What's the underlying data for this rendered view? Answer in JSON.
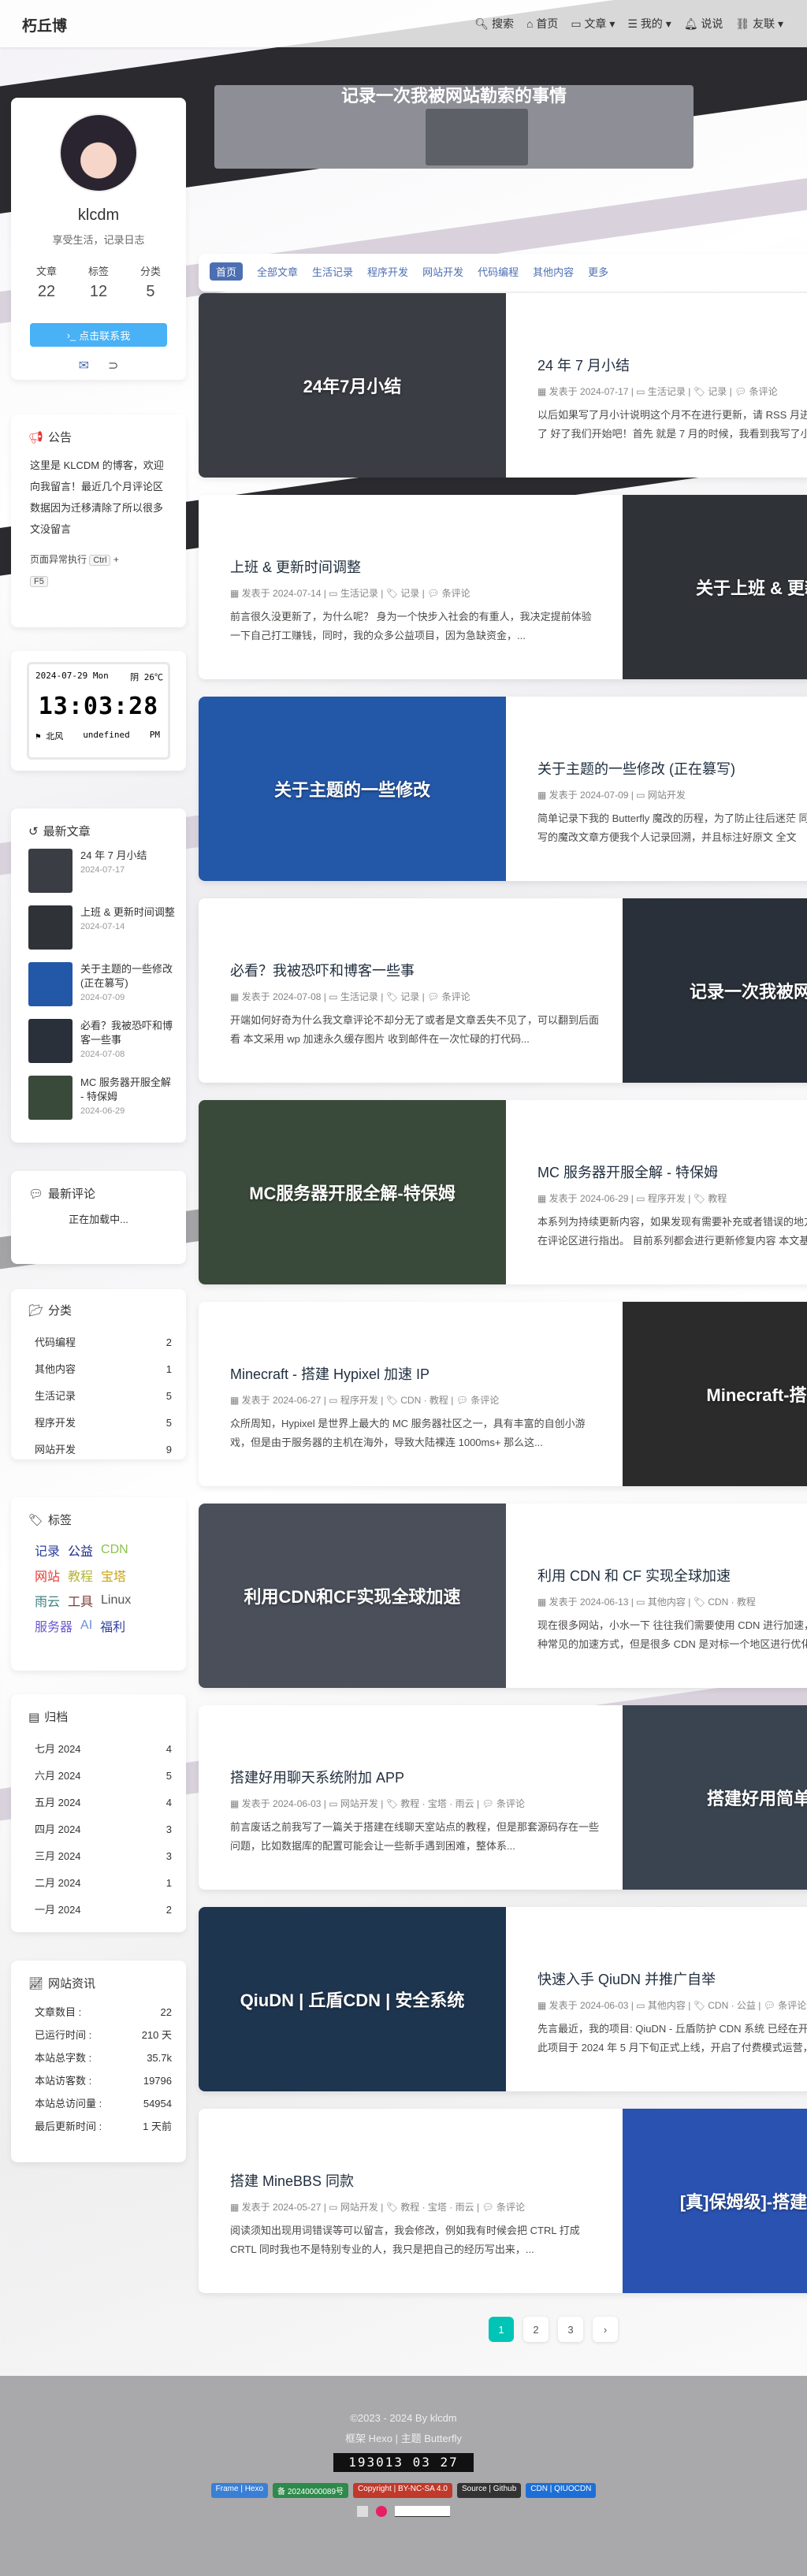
{
  "nav": {
    "site_name": "朽丘博",
    "menus": [
      "搜索",
      "首页",
      "文章",
      "我的",
      "说说",
      "友联"
    ]
  },
  "profile": {
    "name": "klcdm",
    "desc": "享受生活，记录日志",
    "stats": [
      {
        "label": "文章",
        "value": "22"
      },
      {
        "label": "标签",
        "value": "12"
      },
      {
        "label": "分类",
        "value": "5"
      }
    ],
    "contact": "点击联系我"
  },
  "announce": {
    "title": "公告",
    "text": "这里是 KLCDM 的博客，欢迎向我留言！最近几个月评论区数据因为迁移清除了所以很多文没留言",
    "hint_pre": "页面异常执行",
    "key1": "Ctrl",
    "plus": "+",
    "key2": "F5"
  },
  "clock": {
    "date": "2024-07-29",
    "weekday": "Mon",
    "weather": "阴 26℃",
    "time": "13:03:28",
    "wind": "北风",
    "loc": "undefined",
    "ampm": "PM"
  },
  "recent": {
    "title": "最新文章",
    "items": [
      {
        "title": "24 年 7 月小结",
        "date": "2024-07-17"
      },
      {
        "title": "上班 & 更新时间调整",
        "date": "2024-07-14"
      },
      {
        "title": "关于主题的一些修改 (正在篡写)",
        "date": "2024-07-09"
      },
      {
        "title": "必看？我被恐吓和博客一些事",
        "date": "2024-07-08"
      },
      {
        "title": "MC 服务器开服全解 - 特保姆",
        "date": "2024-06-29"
      }
    ]
  },
  "comments": {
    "title": "最新评论",
    "loading": "正在加载中..."
  },
  "categories": {
    "title": "分类",
    "items": [
      {
        "name": "代码编程",
        "count": "2"
      },
      {
        "name": "其他内容",
        "count": "1"
      },
      {
        "name": "生活记录",
        "count": "5"
      },
      {
        "name": "程序开发",
        "count": "5"
      },
      {
        "name": "网站开发",
        "count": "9"
      }
    ]
  },
  "tags": {
    "title": "标签",
    "rows": [
      [
        {
          "t": "记录",
          "c": "#2c3e9e"
        },
        {
          "t": "公益",
          "c": "#1d2a88"
        },
        {
          "t": "CDN",
          "c": "#8bc34a"
        }
      ],
      [
        {
          "t": "网站",
          "c": "#e53935"
        },
        {
          "t": "教程",
          "c": "#b4b43a"
        },
        {
          "t": "宝塔",
          "c": "#c9a215"
        }
      ],
      [
        {
          "t": "雨云",
          "c": "#3f7f7f"
        },
        {
          "t": "工具",
          "c": "#7a3a3a"
        },
        {
          "t": "Linux",
          "c": "#555"
        }
      ],
      [
        {
          "t": "服务器",
          "c": "#6a5acd"
        },
        {
          "t": "AI",
          "c": "#6a8fd0"
        },
        {
          "t": "福利",
          "c": "#2c3e9e"
        }
      ]
    ]
  },
  "archive": {
    "title": "归档",
    "items": [
      {
        "m": "七月 2024",
        "c": "4"
      },
      {
        "m": "六月 2024",
        "c": "5"
      },
      {
        "m": "五月 2024",
        "c": "4"
      },
      {
        "m": "四月 2024",
        "c": "3"
      },
      {
        "m": "三月 2024",
        "c": "3"
      },
      {
        "m": "二月 2024",
        "c": "1"
      },
      {
        "m": "一月 2024",
        "c": "2"
      }
    ]
  },
  "siteinfo": {
    "title": "网站资讯",
    "items": [
      {
        "k": "文章数目 :",
        "v": "22"
      },
      {
        "k": "已运行时间 :",
        "v": "210 天"
      },
      {
        "k": "本站总字数 :",
        "v": "35.7k"
      },
      {
        "k": "本站访客数 :",
        "v": "19796"
      },
      {
        "k": "本站总访问量 :",
        "v": "54954"
      },
      {
        "k": "最后更新时间 :",
        "v": "1 天前"
      }
    ]
  },
  "top_banner": {
    "title": "记录一次我被网站勒索的事情"
  },
  "catbar": [
    "首页",
    "全部文章",
    "生活记录",
    "程序开发",
    "网站开发",
    "代码编程",
    "其他内容",
    "更多"
  ],
  "posts": [
    {
      "title": "24 年 7 月小结",
      "date": "2024-07-17",
      "cat": "生活记录",
      "tags": "记录",
      "cmt": "条评论",
      "exc": "以后如果写了月小计说明这个月不在进行更新，请 RSS 月进行更新了 好了我们开始吧！首先 就是 7 月的时候，我看到我写了小结可以接下来这个月内不用互访避免了不必要的麻烦",
      "cover": "24年7月小结",
      "bg": "#3a3d44"
    },
    {
      "title": "上班 & 更新时间调整",
      "date": "2024-07-14",
      "cat": "生活记录",
      "tags": "记录",
      "cmt": "条评论",
      "exc": "前言很久没更新了，为什么呢？ 身为一个快步入社会的有重人，我决定提前体验一下自己打工赚钱，同时，我的众多公益项目，因为急缺资金，...",
      "cover": "关于上班 & 更新时间",
      "bg": "#2f3338"
    },
    {
      "title": "关于主题的一些修改 (正在篡写)",
      "date": "2024-07-09",
      "cat": "网站开发",
      "tags": "",
      "cmt": "",
      "exc": "简单记录下我的 Butterfly 魔改的历程，为了防止往后迷茫 同时这里写的魔改文章方便我个人记录回溯，并且标注好原文 全文",
      "cover": "关于主题的一些修改",
      "bg": "#2357a8"
    },
    {
      "title": "必看？我被恐吓和博客一些事",
      "date": "2024-07-08",
      "cat": "生活记录",
      "tags": "记录",
      "cmt": "条评论",
      "exc": "开端如何好奇为什么我文章评论不却分无了或者是文章丢失不见了，可以翻到后面看 本文采用 wp 加速永久缓存图片 收到邮件在一次忙碌的打代码...",
      "cover": "记录一次我被网站勒索",
      "bg": "#2a3039"
    },
    {
      "title": "MC 服务器开服全解 - 特保姆",
      "date": "2024-06-29",
      "cat": "程序开发",
      "tags": "教程",
      "cmt": "",
      "exc": "本系列为持续更新内容，如果发现有需要补充或者错误的地方，可以在评论区进行指出。 目前系列都会进行更新修复内容 本文基于 雨云 - 新一代云服务提供商 进行讲解",
      "cover": "MC服务器开服全解-特保姆",
      "bg": "#3a4a3a"
    },
    {
      "title": "Minecraft - 搭建 Hypixel 加速 IP",
      "date": "2024-06-27",
      "cat": "程序开发",
      "tags": "CDN · 教程",
      "cmt": "条评论",
      "exc": "众所周知，Hypixel 是世界上最大的 MC 服务器社区之一，具有丰富的自创小游戏，但是由于服务器的主机在海外，导致大陆裸连 1000ms+ 那么这...",
      "cover": "Minecraft-搭建Hy",
      "bg": "#2b2b2b"
    },
    {
      "title": "利用 CDN 和 CF 实现全球加速",
      "date": "2024-06-13",
      "cat": "其他内容",
      "tags": "CDN · 教程",
      "cmt": "",
      "exc": "现在很多网站，小水一下 往往我们需要使用 CDN 进行加速，这是一种常见的加速方式，但是很多 CDN 是对标一个地区进行优化，例如亚太 CDN 对亚太地区",
      "cover": "利用CDN和CF实现全球加速",
      "bg": "#4a4f5a"
    },
    {
      "title": "搭建好用聊天系统附加 APP",
      "date": "2024-06-03",
      "cat": "网站开发",
      "tags": "教程 · 宝塔 · 雨云",
      "cmt": "条评论",
      "exc": "前言废话之前我写了一篇关于搭建在线聊天室站点的教程，但是那套源码存在一些问题，比如数据库的配置可能会让一些新手遇到困难，整体系...",
      "cover": "搭建好用简单聊天",
      "bg": "#3a4450"
    },
    {
      "title": "快速入手 QiuDN 并推广自举",
      "date": "2024-06-03",
      "cat": "其他内容",
      "tags": "CDN · 公益",
      "cmt": "条评论",
      "exc": "先言最近，我的项目: QiuDN - 丘盾防护 CDN 系统 已经在开发中，此项目于 2024 年 5 月下旬正式上线，开启了付费模式运营，虽然添加了付费模式，但是现在",
      "cover": "QiuDN | 丘盾CDN | 安全系统",
      "bg": "#1e3550"
    },
    {
      "title": "搭建 MineBBS 同款",
      "date": "2024-05-27",
      "cat": "网站开发",
      "tags": "教程 · 宝塔 · 雨云",
      "cmt": "条评论",
      "exc": "阅读须知出现用词错误等可以留言，我会修改，例如我有时候会把 CTRL 打成 CRTL 同时我也不是特别专业的人，我只是把自己的经历写出来，...",
      "cover": "[真]保姆级]-搭建M -原创-",
      "bg": "#2a52b0"
    }
  ],
  "posted": "发表于",
  "pager": [
    "1",
    "2",
    "3"
  ],
  "footer": {
    "copy": "©2023 - 2024 By klcdm",
    "frame": "框架 Hexo | 主题 Butterfly",
    "counter": "193013 03 27",
    "badges": [
      "Frame | Hexo",
      "备 20240000089号",
      "Copyright | BY-NC-SA 4.0",
      "Source | Github",
      "CDN | QIUOCDN"
    ]
  }
}
